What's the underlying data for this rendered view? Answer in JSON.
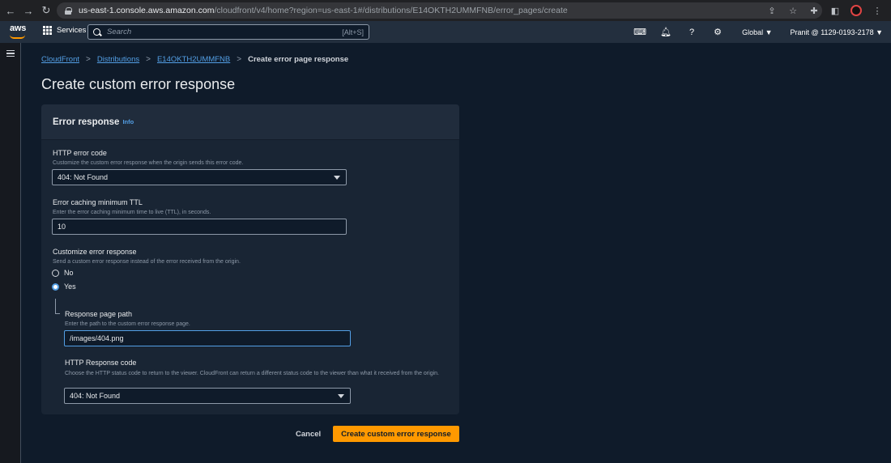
{
  "browser": {
    "url_domain": "us-east-1.console.aws.amazon.com",
    "url_path": "/cloudfront/v4/home?region=us-east-1#/distributions/E14OKTH2UMMFNB/error_pages/create"
  },
  "aws_nav": {
    "logo": "aws",
    "services_label": "Services",
    "search_placeholder": "Search",
    "search_shortcut": "[Alt+S]",
    "region": "Global ▼",
    "account": "Pranit @ 1129-0193-2178 ▼"
  },
  "breadcrumb": {
    "items": [
      "CloudFront",
      "Distributions",
      "E14OKTH2UMMFNB"
    ],
    "current": "Create error page response"
  },
  "page_title": "Create custom error response",
  "panel": {
    "title": "Error response",
    "info": "Info",
    "http_error_code": {
      "label": "HTTP error code",
      "desc": "Customize the custom error response when the origin sends this error code.",
      "value": "404: Not Found"
    },
    "ttl": {
      "label": "Error caching minimum TTL",
      "desc": "Enter the error caching minimum time to live (TTL), in seconds.",
      "value": "10"
    },
    "customize": {
      "label": "Customize error response",
      "desc": "Send a custom error response instead of the error received from the origin.",
      "options": [
        "No",
        "Yes"
      ],
      "selected": "Yes"
    },
    "response_page_path": {
      "label": "Response page path",
      "desc": "Enter the path to the custom error response page.",
      "value": "/images/404.png"
    },
    "http_response_code": {
      "label": "HTTP Response code",
      "desc": "Choose the HTTP status code to return to the viewer. CloudFront can return a different status code to the viewer than what it received from the origin.",
      "value": "404: Not Found"
    }
  },
  "actions": {
    "cancel": "Cancel",
    "submit": "Create custom error response"
  },
  "colors": {
    "accent": "#ff9900",
    "link": "#539fe5"
  }
}
